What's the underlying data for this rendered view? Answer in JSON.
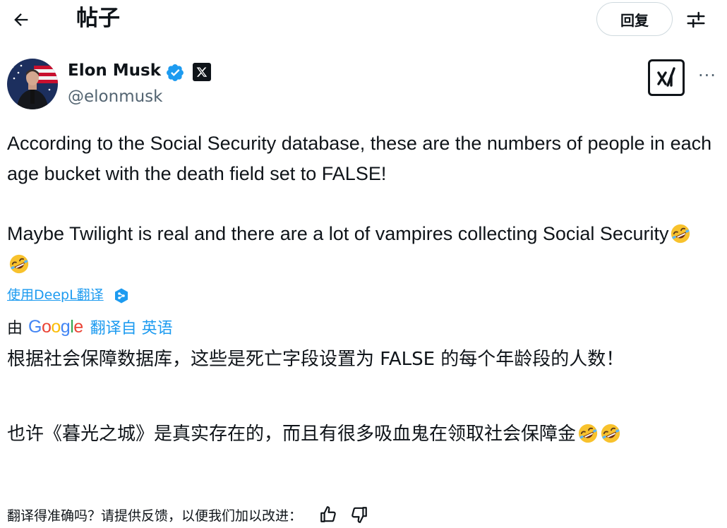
{
  "header": {
    "title": "帖子",
    "reply_label": "回复",
    "back_icon": "arrow-left-icon",
    "filter_icon": "sliders-icon"
  },
  "author": {
    "name": "Elon Musk",
    "handle": "@elonmusk",
    "verified_icon": "verified-badge-icon",
    "affiliate_icon": "x-logo-icon",
    "grok_icon": "grok-icon",
    "more_label": "···"
  },
  "tweet": {
    "paragraph_1": "According to the Social Security database, these are the numbers of people in each age bucket with the death field set to FALSE!",
    "paragraph_2": "Maybe Twilight is real and there are a lot of vampires collecting Social Security",
    "emoji": "rolling-on-floor-laughing"
  },
  "translation": {
    "deepl_label": "使用DeepL翻译",
    "google_prefix": "由",
    "google_logo": "Google",
    "google_suffix": "翻译自 英语",
    "paragraph_1": "根据社会保障数据库，这些是死亡字段设置为 FALSE 的每个年龄段的人数！",
    "paragraph_2": "也许《暮光之城》是真实存在的，而且有很多吸血鬼在领取社会保障金"
  },
  "feedback": {
    "prompt": "翻译得准确吗？请提供反馈，以便我们加以改进：",
    "thumbs_up_icon": "thumbs-up-icon",
    "thumbs_down_icon": "thumbs-down-icon"
  },
  "colors": {
    "accent": "#1d9bf0",
    "text": "#0f1419",
    "secondary": "#536471",
    "border": "#cfd9de"
  }
}
